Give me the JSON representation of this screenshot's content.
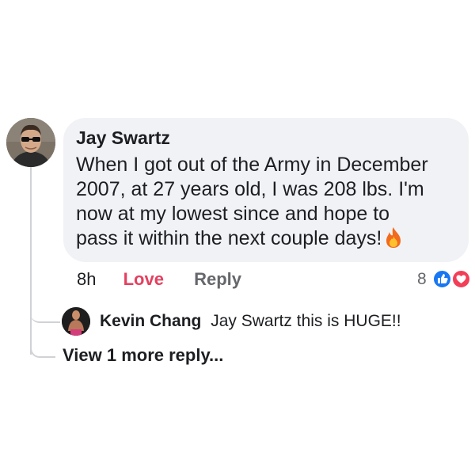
{
  "comment": {
    "author": "Jay Swartz",
    "text_lines": [
      "When I got out of the Army in December",
      "2007, at 27 years old, I was 208 lbs. I'm",
      "now at my lowest since and hope to",
      "pass it within the next couple days!"
    ],
    "emoji_icon": "fire-icon",
    "time": "8h",
    "love_label": "Love",
    "reply_label": "Reply",
    "reaction_count": "8",
    "reaction_icons": [
      "like-icon",
      "love-icon"
    ],
    "love_color": "#e4405f"
  },
  "reply": {
    "author": "Kevin Chang",
    "text": "Jay Swartz this is HUGE!!"
  },
  "view_more": "View 1 more reply..."
}
